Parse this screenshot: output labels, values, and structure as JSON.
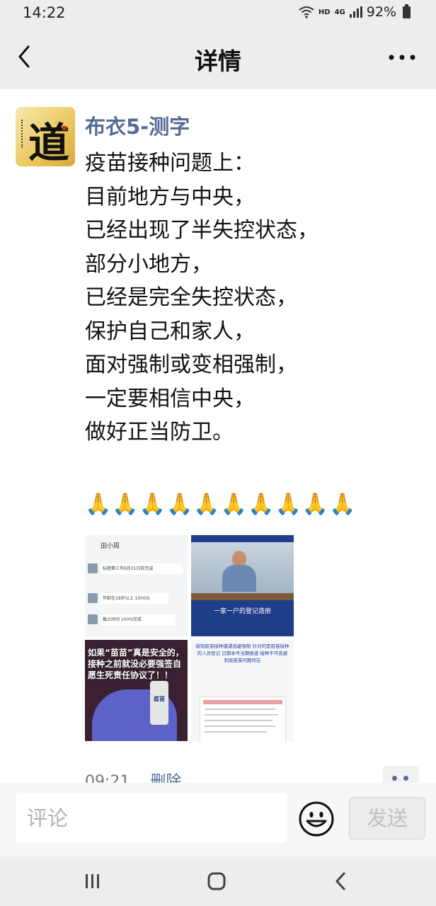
{
  "status_bar": {
    "time": "14:22",
    "network_label": "HD",
    "network_type": "4G",
    "battery": "92%"
  },
  "nav": {
    "title": "详情",
    "back_icon": "chevron-left-icon",
    "more_icon": "more-dots-icon"
  },
  "post": {
    "avatar_glyph": "道",
    "username": "布衣5-测字",
    "lines": [
      "疫苗接种问题上：",
      "目前地方与中央，",
      "已经出现了半失控状态，",
      "部分小地方，",
      "已经是完全失控状态，",
      "保护自己和家人，",
      "面对强制或变相强制，",
      "一定要相信中央，",
      "做好正当防卫。"
    ],
    "prayers": "🙏🙏🙏🙏🙏🙏🙏🙏🙏🙏",
    "images": [
      {
        "header": "田小周 ",
        "messages": [
          "标题第三年8月31日前完成",
          "年龄在18岁以上 1000元",
          "截止时间 100%完成"
        ]
      },
      {
        "caption": "一家一户的登记造册"
      },
      {
        "overlay": "如果“苗苗”真是安全的，接种之前就没必要强签自愿生死责任协议了！！",
        "vial_label": "疫苗"
      },
      {
        "text": "新冠疫苗接种遭遇逃避强制 针对的是疫苗接种的人员登记 日期本号当期报道 接种不可逃避 到底疫苗问题何在"
      }
    ],
    "time": "09:21",
    "delete_label": "删除"
  },
  "comment_bar": {
    "placeholder": "评论",
    "send_label": "发送",
    "emoji_icon": "smiley-icon"
  },
  "system_nav": {
    "recents_icon": "recents-icon",
    "home_icon": "home-icon",
    "back_icon": "back-icon"
  }
}
